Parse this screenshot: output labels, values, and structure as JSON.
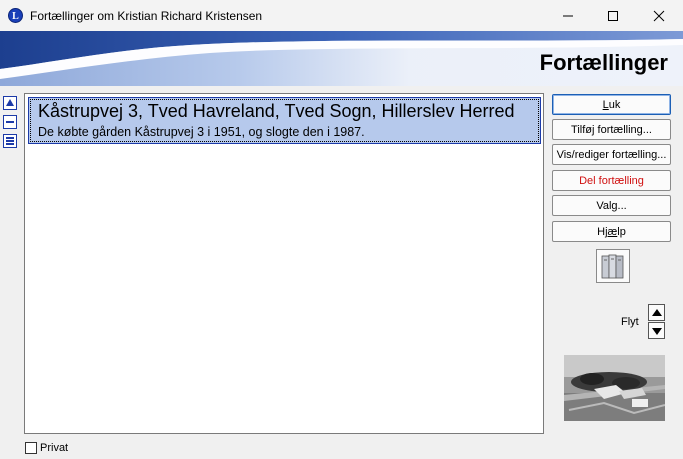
{
  "window": {
    "title": "Fortællinger om Kristian Richard Kristensen",
    "app_icon_letter": "L"
  },
  "banner": {
    "title": "Fortællinger"
  },
  "stories": [
    {
      "title": "Kåstrupvej 3, Tved Havreland, Tved Sogn, Hillerslev Herred",
      "description": "De købte gården Kåstrupvej 3 i 1951, og slogte den i 1987."
    }
  ],
  "buttons": {
    "luk": {
      "label_u": "L",
      "label_rest": "uk"
    },
    "add": "Tilføj fortælling...",
    "edit": "Vis/rediger fortælling...",
    "delete": "Del fortælling",
    "options": "Valg...",
    "help": {
      "label_pre": "Hj",
      "label_u": "æ",
      "label_post": "lp"
    }
  },
  "move": {
    "label": "Flyt"
  },
  "private": {
    "label": "Privat",
    "checked": false
  },
  "colors": {
    "accent": "#1c3aa8",
    "selection": "#b6c9ec",
    "danger": "#d01010"
  }
}
